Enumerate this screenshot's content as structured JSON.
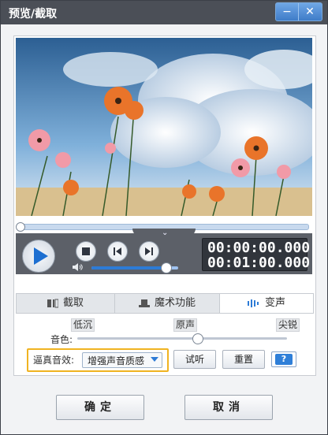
{
  "window": {
    "title": "预览/截取"
  },
  "titlebar": {
    "min_symbol": "−",
    "close_symbol": "✕"
  },
  "player": {
    "time_current": "00:00:00.000",
    "time_total": "00:01:00.000",
    "seek_position": 0,
    "volume_level": 0.85
  },
  "tabs": [
    {
      "label": "截取",
      "icon": "crop-icon",
      "active": false
    },
    {
      "label": "魔术功能",
      "icon": "magic-hat-icon",
      "active": false
    },
    {
      "label": "变声",
      "icon": "sound-wave-icon",
      "active": true
    }
  ],
  "voice": {
    "labels": {
      "low": "低沉",
      "original": "原声",
      "sharp": "尖锐"
    },
    "tone_label": "音色:",
    "tone_level": 0.57,
    "effect_label": "逼真音效:",
    "effect_value": "增强声音质感",
    "listen_button": "试听",
    "reset_button": "重置",
    "help_text": "?"
  },
  "footer": {
    "ok": "确定",
    "cancel": "取消"
  },
  "colors": {
    "accent": "#2d7bd6",
    "highlight_border": "#f0b321",
    "titlebar": "#4b4f57"
  }
}
